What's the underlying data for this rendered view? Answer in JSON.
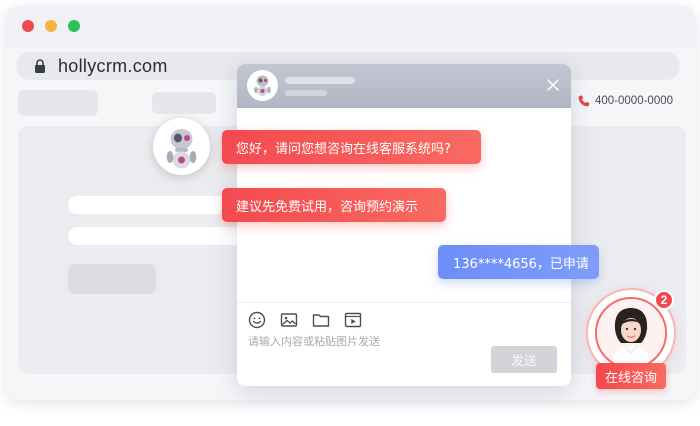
{
  "browser": {
    "url": "hollycrm.com"
  },
  "header": {
    "phone_number": "400-0000-0000"
  },
  "chat": {
    "messages": [
      {
        "from": "bot",
        "text": "您好，请问您想咨询在线客服系统吗?"
      },
      {
        "from": "bot",
        "text": "建议先免费试用，咨询预约演示"
      },
      {
        "from": "user",
        "text": "136****4656，已申请"
      }
    ],
    "input_placeholder": "请输入内容或粘贴图片发送",
    "send_label": "发送",
    "toolbar_icons": [
      "emoji-icon",
      "image-icon",
      "folder-icon",
      "video-icon"
    ]
  },
  "agent_widget": {
    "badge_count": "2",
    "label": "在线咨询"
  },
  "colors": {
    "accent_red": "#f44a4f",
    "user_bubble_blue": "#6d8ef8",
    "header_grey": "#b8bbc8"
  }
}
